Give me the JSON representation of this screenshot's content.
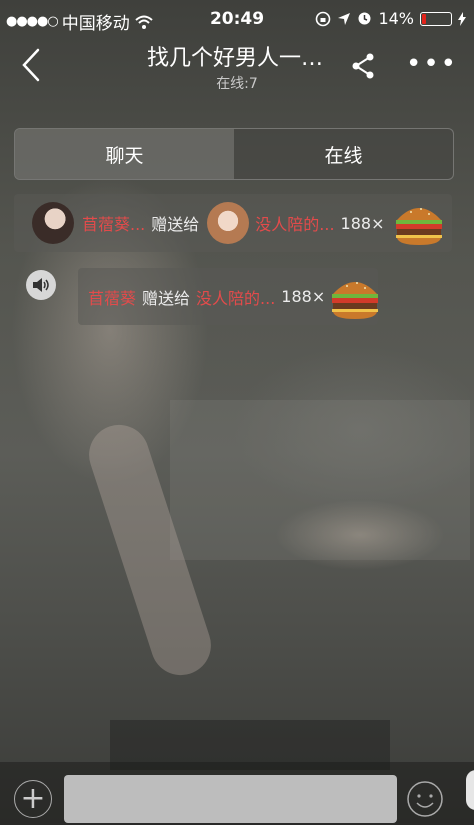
{
  "status_bar": {
    "signal_dots": "●●●●○",
    "carrier": "中国移动",
    "wifi_icon": "wifi-icon",
    "time": "20:49",
    "battery_percent": "14%",
    "battery_level": 0.14,
    "battery_color": "#e2231a"
  },
  "nav": {
    "title": "找几个好男人一…",
    "subtitle": "在线:7"
  },
  "tabs": [
    {
      "label": "聊天",
      "active": true
    },
    {
      "label": "在线",
      "active": false
    }
  ],
  "messages": [
    {
      "sender": "苜蓿葵...",
      "action": "赠送给",
      "receiver": "没人陪的...",
      "quantity": "188×",
      "gift_icon": "burger-icon"
    },
    {
      "sender": "苜蓿葵",
      "action": "赠送给",
      "receiver": "没人陪的...",
      "quantity": "188×",
      "gift_icon": "burger-icon"
    }
  ],
  "input": {
    "placeholder": ""
  },
  "colors": {
    "highlight_name": "#e24b4b",
    "battery_low": "#e2231a"
  }
}
